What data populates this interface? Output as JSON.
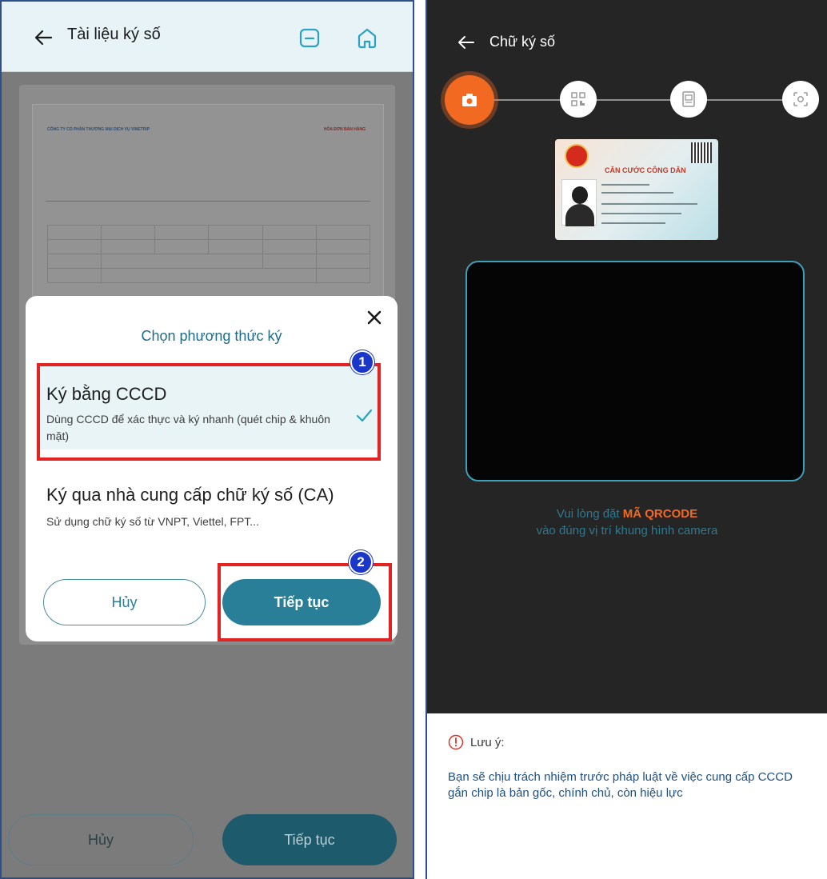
{
  "left": {
    "header": {
      "title": "Tài liệu ký số"
    },
    "document_preview": {
      "company": "CÔNG TY CỔ PHẦN THƯƠNG MẠI DỊCH VỤ VINETRIP",
      "doc_type": "HÓA ĐƠN BÁN HÀNG"
    },
    "bottom_buttons": {
      "cancel": "Hủy",
      "continue": "Tiếp tục"
    }
  },
  "modal": {
    "title": "Chọn phương thức ký",
    "options": [
      {
        "title": "Ký bằng CCCD",
        "description": "Dùng CCCD để xác thực và ký nhanh (quét chip & khuôn mặt)",
        "selected": true
      },
      {
        "title": "Ký qua nhà cung cấp chữ ký số (CA)",
        "description": "Sử dụng chữ ký số từ VNPT, Viettel, FPT...",
        "selected": false
      }
    ],
    "cancel_label": "Hủy",
    "continue_label": "Tiếp tục"
  },
  "annotations": {
    "badge_1": "1",
    "badge_2": "2"
  },
  "right": {
    "header": {
      "title": "Chữ ký số"
    },
    "steps": [
      "camera-icon",
      "qr-icon",
      "document-scan-icon",
      "face-scan-icon"
    ],
    "active_step": 1,
    "id_card": {
      "title": "CĂN CƯỚC CÔNG DÂN"
    },
    "instruction": {
      "prefix": "Vui lòng đặt ",
      "highlight": "MÃ QRCODE",
      "suffix": "vào đúng vị trí khung hình camera"
    },
    "note": {
      "title": "Lưu ý:",
      "text": "Bạn sẽ chịu trách nhiệm trước pháp luật về việc cung cấp CCCD gắn chip là bản gốc, chính chủ, còn hiệu lực"
    }
  },
  "colors": {
    "accent": "#2a7f98",
    "highlight": "#e32222",
    "badge": "#1a37c9",
    "orange": "#f26a21"
  }
}
